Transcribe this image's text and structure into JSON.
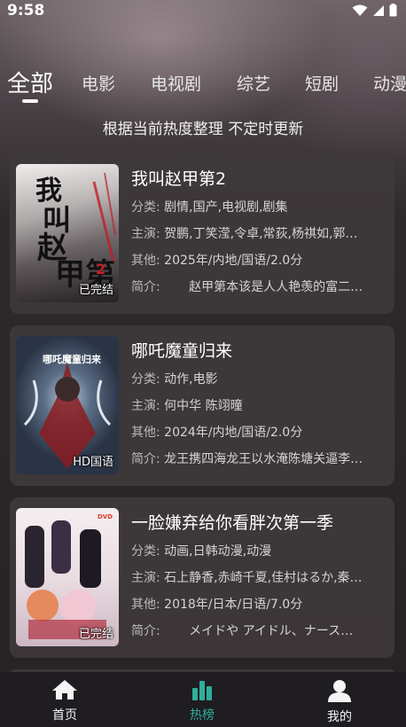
{
  "status_bar": {
    "time": "9:58"
  },
  "tabs": [
    {
      "label": "全部",
      "active": true
    },
    {
      "label": "电影"
    },
    {
      "label": "电视剧"
    },
    {
      "label": "综艺"
    },
    {
      "label": "短剧"
    },
    {
      "label": "动漫"
    }
  ],
  "subtitle": "根据当前热度整理 不定时更新",
  "items": [
    {
      "title": "我叫赵甲第2",
      "badge": "已完结",
      "category_label": "分类:",
      "category": "剧情,国产,电视剧,剧集",
      "cast_label": "主演:",
      "cast": "贺鹏,丁笑滢,令卓,常荻,杨祺如,郭…",
      "other_label": "其他:",
      "other": "2025年/内地/国语/2.0分",
      "intro_label": "简介:",
      "intro": "　　赵甲第本该是人人艳羡的富二…",
      "poster_text": "我叫赵甲第2"
    },
    {
      "title": "哪吒魔童归来",
      "badge": "HD国语",
      "category_label": "分类:",
      "category": "动作,电影",
      "cast_label": "主演:",
      "cast": "何中华 陈翊曈",
      "other_label": "其他:",
      "other": "2024年/内地/国语/2.0分",
      "intro_label": "简介:",
      "intro": "龙王携四海龙王以水淹陈塘关逼李…",
      "poster_text": "哪吒魔童归来"
    },
    {
      "title": "一脸嫌弃给你看胖次第一季",
      "badge": "已完结",
      "category_label": "分类:",
      "category": "动画,日韩动漫,动漫",
      "cast_label": "主演:",
      "cast": "石上静香,赤崎千夏,佳村はるか,秦…",
      "other_label": "其他:",
      "other": "2018年/日本/日语/7.0分",
      "intro_label": "简介:",
      "intro": "　　メイドや アイドル、ナース…",
      "poster_text": ""
    }
  ],
  "bottom_nav": [
    {
      "label": "首页",
      "icon": "home-icon",
      "active": false
    },
    {
      "label": "热榜",
      "icon": "chart-icon",
      "active": true
    },
    {
      "label": "我的",
      "icon": "user-icon",
      "active": false
    }
  ],
  "colors": {
    "accent": "#2fae9c",
    "nav_bg": "#1f1d21",
    "card_bg": "#3e383b"
  }
}
